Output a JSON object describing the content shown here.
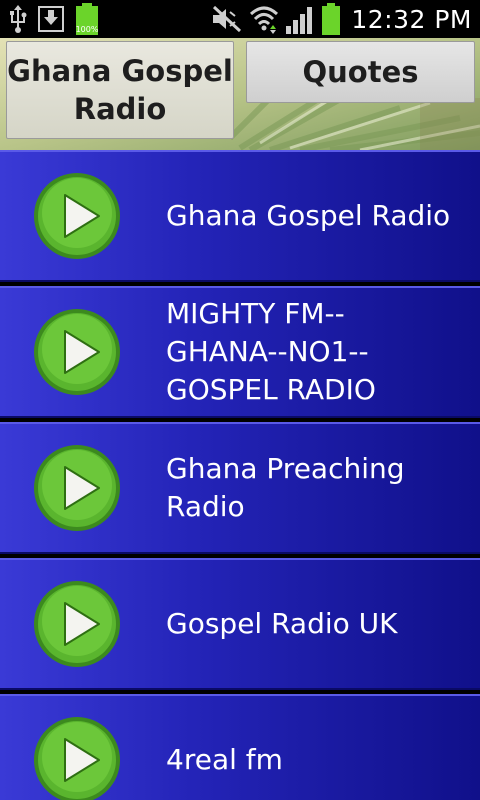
{
  "status_bar": {
    "time": "12:32 PM",
    "battery_small_label": "100%",
    "icons": [
      "usb-icon",
      "download-icon",
      "battery-full-icon",
      "mute-icon",
      "wifi-icon",
      "signal-icon",
      "battery-icon"
    ]
  },
  "header": {
    "title_button": "Ghana Gospel Radio",
    "quotes_button": "Quotes"
  },
  "stations": [
    {
      "name": "Ghana Gospel Radio"
    },
    {
      "name": "MIGHTY FM--\nGHANA--NO1--\nGOSPEL RADIO"
    },
    {
      "name": "Ghana Preaching\nRadio"
    },
    {
      "name": "Gospel Radio UK"
    },
    {
      "name": "4real fm"
    }
  ],
  "colors": {
    "list_bg_start": "#3a3ad6",
    "list_bg_end": "#10108a",
    "play_button_green": "#4caf28",
    "battery_green": "#6bd42a"
  }
}
